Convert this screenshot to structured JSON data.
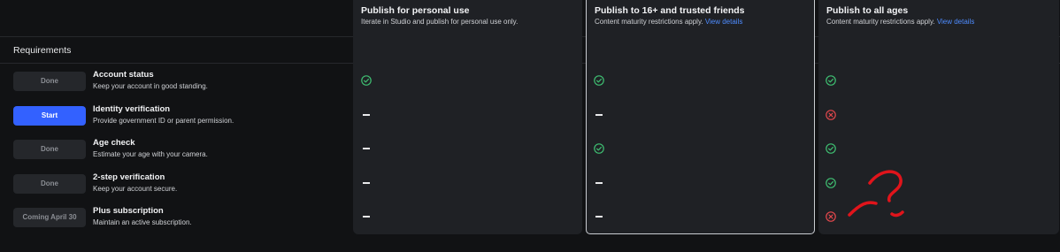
{
  "requirements_label": "Requirements",
  "columns": [
    {
      "title": "Publish for personal use",
      "subtitle": "Iterate in Studio and publish for personal use only.",
      "link": ""
    },
    {
      "title": "Publish to 16+ and trusted friends",
      "subtitle": "Content maturity restrictions apply.",
      "link": "View details"
    },
    {
      "title": "Publish to all ages",
      "subtitle": "Content maturity restrictions apply.",
      "link": "View details"
    }
  ],
  "rows": [
    {
      "button": "Done",
      "title": "Account status",
      "desc": "Keep your account in good standing.",
      "status": [
        "check",
        "check",
        "check"
      ]
    },
    {
      "button": "Start",
      "title": "Identity verification",
      "desc": "Provide government ID or parent permission.",
      "status": [
        "dash",
        "dash",
        "cross"
      ]
    },
    {
      "button": "Done",
      "title": "Age check",
      "desc": "Estimate your age with your camera.",
      "status": [
        "dash",
        "check",
        "check"
      ]
    },
    {
      "button": "Done",
      "title": "2-step verification",
      "desc": "Keep your account secure.",
      "status": [
        "dash",
        "dash",
        "check"
      ]
    },
    {
      "button": "Coming April 30",
      "title": "Plus subscription",
      "desc": "Maintain an active subscription.",
      "status": [
        "dash",
        "dash",
        "cross"
      ]
    }
  ],
  "colors": {
    "check": "#3fbf72",
    "cross": "#e5484d",
    "primary": "#3361ff",
    "link": "#4e8cff",
    "annotation": "#e0141b"
  }
}
